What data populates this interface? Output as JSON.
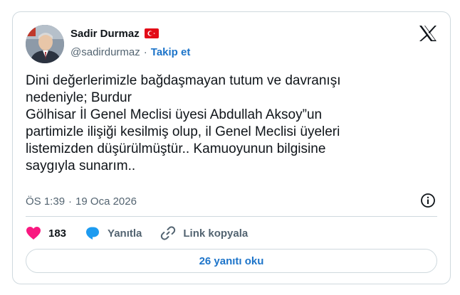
{
  "author": {
    "display_name": "Sadir Durmaz",
    "handle": "@sadirdurmaz",
    "separator": "·",
    "follow_label": "Takip et",
    "flag_icon": "turkey-flag-icon",
    "avatar_icon": "profile-avatar"
  },
  "brand": {
    "logo_icon": "x-logo-icon"
  },
  "tweet": {
    "text": "Dini değerlerimizle bağdaşmayan tutum ve davranışı\nnedeniyle; Burdur\nGölhisar İl Genel Meclisi üyesi Abdullah Aksoy”un\npartimizle ilişiği kesilmiş olup, il Genel Meclisi üyeleri\nlistemizden düşürülmüştür.. Kamuoyunun bilgisine\nsaygıyla sunarım..",
    "time": "ÖS 1:39",
    "date_separator": "·",
    "date": "19 Oca 2026",
    "info_icon": "info-icon"
  },
  "actions": {
    "like_count": "183",
    "reply_label": "Yanıtla",
    "copy_link_label": "Link kopyala"
  },
  "replies_button_label": "26 yanıtı oku",
  "colors": {
    "accent": "#1d74c9",
    "like": "#f91880",
    "reply_icon": "#1d9bf0",
    "muted": "#536471",
    "border": "#cfd9de",
    "flag_red": "#e30a17"
  }
}
